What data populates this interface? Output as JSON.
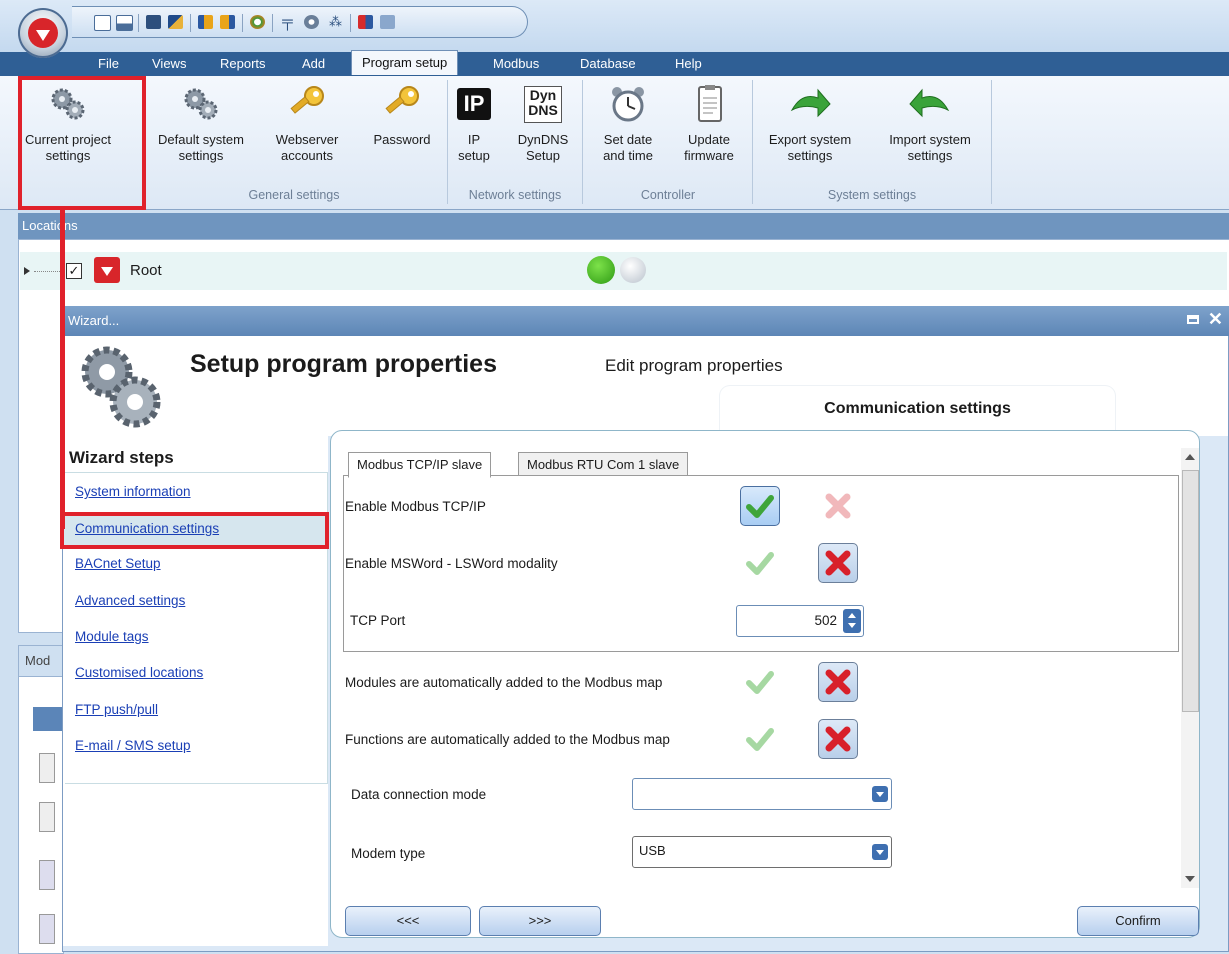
{
  "menu": {
    "items": [
      "File",
      "Views",
      "Reports",
      "Add",
      "Program setup",
      "Modbus",
      "Database",
      "Help"
    ],
    "active": "Program setup"
  },
  "ribbon": {
    "buttons": [
      {
        "label1": "Current project",
        "label2": "settings",
        "icon": "gears-icon"
      },
      {
        "label1": "Default system",
        "label2": "settings",
        "icon": "gears-icon"
      },
      {
        "label1": "Webserver",
        "label2": "accounts",
        "icon": "key-icon"
      },
      {
        "label1": "Password",
        "label2": "",
        "icon": "key-icon"
      },
      {
        "label1": "IP",
        "label2": "setup",
        "icon": "ip-icon"
      },
      {
        "label1": "DynDNS",
        "label2": "Setup",
        "icon": "dyndns-icon"
      },
      {
        "label1": "Set date",
        "label2": "and time",
        "icon": "alarm-clock-icon"
      },
      {
        "label1": "Update",
        "label2": "firmware",
        "icon": "document-icon"
      },
      {
        "label1": "Export system",
        "label2": "settings",
        "icon": "export-arrow-icon"
      },
      {
        "label1": "Import system",
        "label2": "settings",
        "icon": "import-arrow-icon"
      }
    ],
    "ip_icon_text": "IP",
    "dyn_icon_text1": "Dyn",
    "dyn_icon_text2": "DNS",
    "groups": [
      "General settings",
      "Network settings",
      "Controller",
      "System settings"
    ]
  },
  "locations": {
    "header": "Locations",
    "root_label": "Root",
    "root_checked": true
  },
  "modules_tab": "Mod",
  "wizard": {
    "window_title": "Wizard...",
    "heading": "Setup program properties",
    "subheading": "Edit program properties",
    "section_title": "Communication settings",
    "steps_title": "Wizard steps",
    "steps": [
      "System information",
      "Communication settings",
      "BACnet Setup",
      "Advanced settings",
      "Module tags",
      "Customised locations",
      "FTP push/pull",
      "E-mail / SMS setup"
    ],
    "active_step": "Communication settings",
    "tabs": [
      "Modbus TCP/IP slave",
      "Modbus RTU Com 1 slave"
    ],
    "active_tab": "Modbus TCP/IP slave",
    "fields": {
      "enable_tcp": {
        "label": "Enable Modbus TCP/IP",
        "value": true
      },
      "msword": {
        "label": "Enable MSWord - LSWord modality",
        "value": false
      },
      "tcp_port": {
        "label": "TCP Port",
        "value": "502"
      },
      "modules_auto": {
        "label": "Modules are automatically added to the Modbus map",
        "value": false
      },
      "functions_auto": {
        "label": "Functions are automatically added to the Modbus map",
        "value": false
      },
      "data_connection": {
        "label": "Data connection mode",
        "value": ""
      },
      "modem_type": {
        "label": "Modem type",
        "value": "USB"
      }
    },
    "nav": {
      "prev": "<<<",
      "next": ">>>",
      "confirm": "Confirm"
    }
  },
  "colors": {
    "accent": "#2f5f95",
    "highlight": "#e0212b",
    "check_green": "#4caf3f",
    "cross_red": "#d8202a"
  }
}
